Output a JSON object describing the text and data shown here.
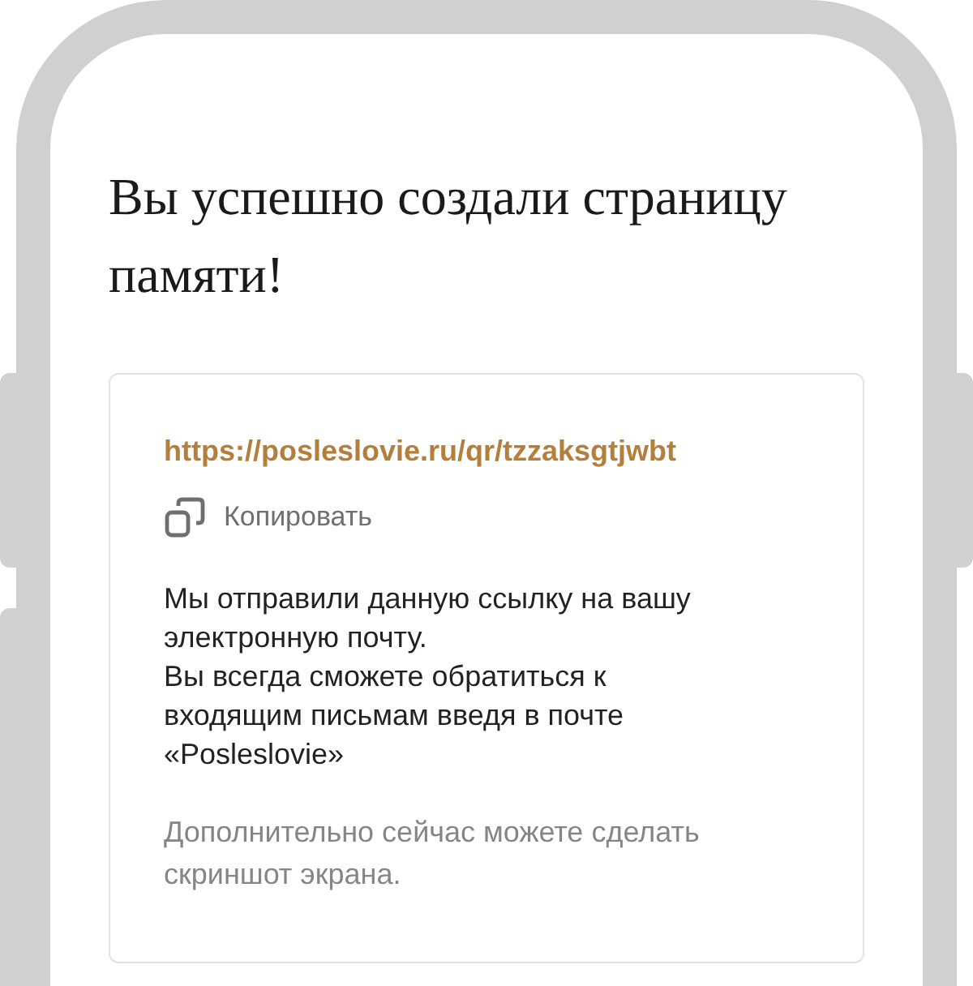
{
  "title": "Вы успешно создали страницу памяти!",
  "card": {
    "link": "https://posleslovie.ru/qr/tzzaksgtjwbt",
    "copy_button": "Копировать",
    "message": [
      "Мы отправили данную ссылку на вашу электронную почту.",
      "Вы всегда сможете обратиться к входящим письмам введя в почте «Posleslovie»"
    ],
    "note": "Дополнительно сейчас можете сделать скриншот экрана."
  }
}
